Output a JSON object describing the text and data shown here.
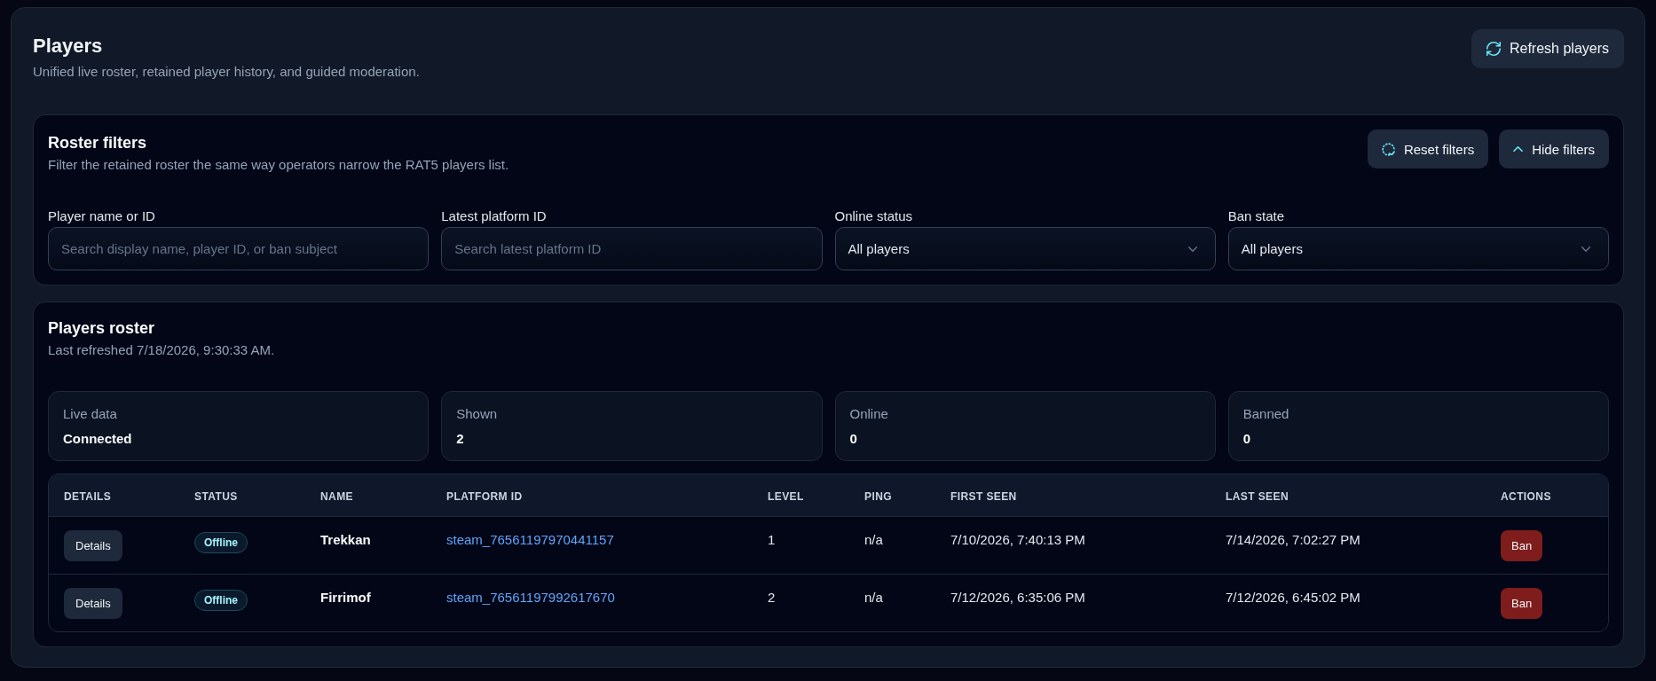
{
  "page": {
    "title": "Players",
    "subtitle": "Unified live roster, retained player history, and guided moderation.",
    "refresh_button": "Refresh players"
  },
  "filters": {
    "title": "Roster filters",
    "description": "Filter the retained roster the same way operators narrow the RAT5 players list.",
    "buttons": [
      {
        "kind": "reset",
        "label": "Reset filters"
      },
      {
        "kind": "hide",
        "label": "Hide filters"
      }
    ],
    "fields": [
      {
        "kind": "input",
        "label": "Player name or ID",
        "placeholder": "Search display name, player ID, or ban subject"
      },
      {
        "kind": "input",
        "label": "Latest platform ID",
        "placeholder": "Search latest platform ID"
      },
      {
        "kind": "select",
        "label": "Online status",
        "value": "All players"
      },
      {
        "kind": "select",
        "label": "Ban state",
        "value": "All players"
      }
    ]
  },
  "roster": {
    "title": "Players roster",
    "subtitle": "Last refreshed 7/18/2026, 9:30:33 AM.",
    "stats": [
      {
        "label": "Live data",
        "value": "Connected"
      },
      {
        "label": "Shown",
        "value": "2"
      },
      {
        "label": "Online",
        "value": "0"
      },
      {
        "label": "Banned",
        "value": "0"
      }
    ],
    "table": {
      "columns": [
        "DETAILS",
        "STATUS",
        "NAME",
        "PLATFORM ID",
        "LEVEL",
        "PING",
        "FIRST SEEN",
        "LAST SEEN",
        "ACTIONS"
      ],
      "rows": [
        {
          "details": "Details",
          "status": "Offline",
          "name": "Trekkan",
          "platform_id": "steam_76561197970441157",
          "player_level": "1",
          "ping": "n/a",
          "first_seen": "7/10/2026, 7:40:13 PM",
          "last_seen": "7/14/2026, 7:02:27 PM",
          "action": "Ban"
        },
        {
          "details": "Details",
          "status": "Offline",
          "name": "Firrimof",
          "platform_id": "steam_76561197992617670",
          "player_level": "2",
          "ping": "n/a",
          "first_seen": "7/12/2026, 6:35:06 PM",
          "last_seen": "7/12/2026, 6:45:02 PM",
          "action": "Ban"
        }
      ]
    }
  }
}
